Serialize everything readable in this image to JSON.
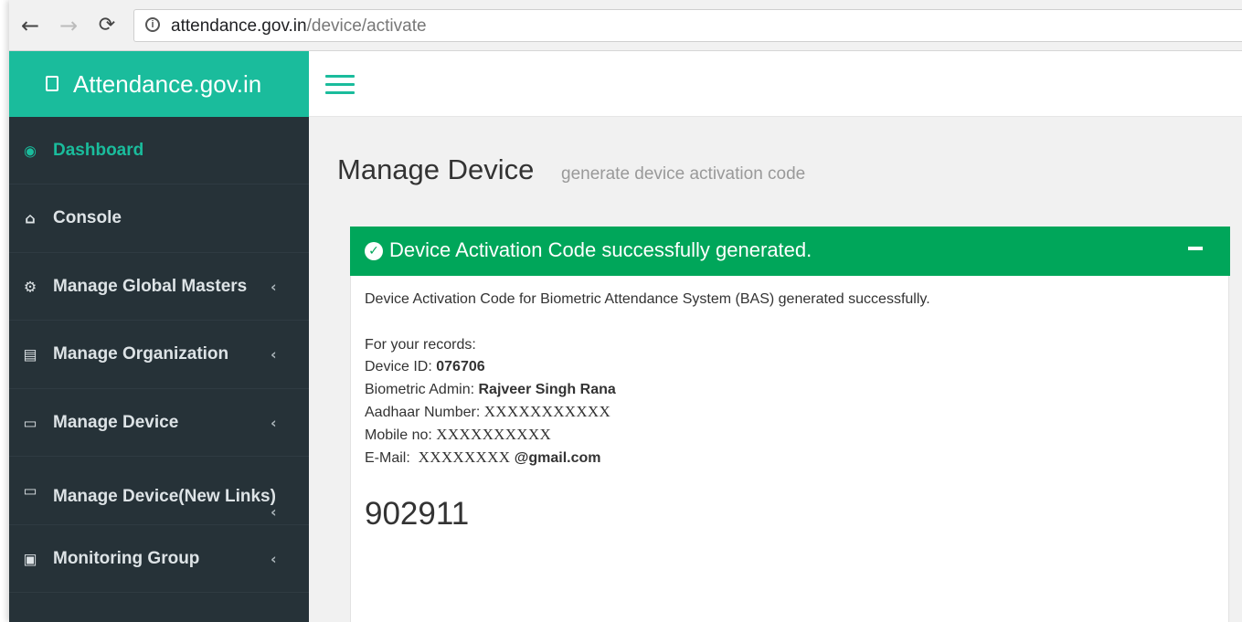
{
  "browser": {
    "back_icon": "←",
    "forward_icon": "→",
    "reload_icon": "C",
    "url_host": "attendance.gov.in",
    "url_path": "/device/activate"
  },
  "header": {
    "logo_text": "Attendance.gov.in"
  },
  "sidebar": {
    "items": [
      {
        "label": "Dashboard",
        "icon": "dashboard-icon",
        "glyph": "◉",
        "active": true,
        "submenu": false
      },
      {
        "label": "Console",
        "icon": "home-icon",
        "glyph": "⌂",
        "active": false,
        "submenu": false
      },
      {
        "label": "Manage Global Masters",
        "icon": "cogs-icon",
        "glyph": "⚙",
        "active": false,
        "submenu": true
      },
      {
        "label": "Manage Organization",
        "icon": "building-icon",
        "glyph": "▤",
        "active": false,
        "submenu": true
      },
      {
        "label": "Manage Device",
        "icon": "laptop-icon",
        "glyph": "▭",
        "active": false,
        "submenu": true
      },
      {
        "label": "Manage Device(New Links)",
        "icon": "laptop-icon",
        "glyph": "▭",
        "active": false,
        "submenu": true
      },
      {
        "label": "Monitoring Group",
        "icon": "calendar-icon",
        "glyph": "▣",
        "active": false,
        "submenu": true
      }
    ],
    "chevron": "‹"
  },
  "page": {
    "title": "Manage Device",
    "subtitle": "generate device activation code"
  },
  "panel": {
    "header": "Device Activation Code successfully generated.",
    "check_glyph": "✓",
    "message": "Device Activation Code for Biometric Attendance System (BAS) generated successfully.",
    "records_label": "For your records:",
    "device_id_label": "Device ID: ",
    "device_id": "076706",
    "admin_label": "Biometric Admin: ",
    "admin": "Rajveer Singh Rana",
    "aadhaar_label": "Aadhaar Number: ",
    "aadhaar": "XXXXXXXXXXX",
    "mobile_label": "Mobile no: ",
    "mobile": "XXXXXXXXXX",
    "email_label": "E-Mail:  ",
    "email_masked": "XXXXXXXX",
    "email_domain": "@gmail.com",
    "activation_code": "902911"
  },
  "colors": {
    "accent": "#1abc9c",
    "success": "#00a65a",
    "sidebar_bg": "#263238"
  }
}
